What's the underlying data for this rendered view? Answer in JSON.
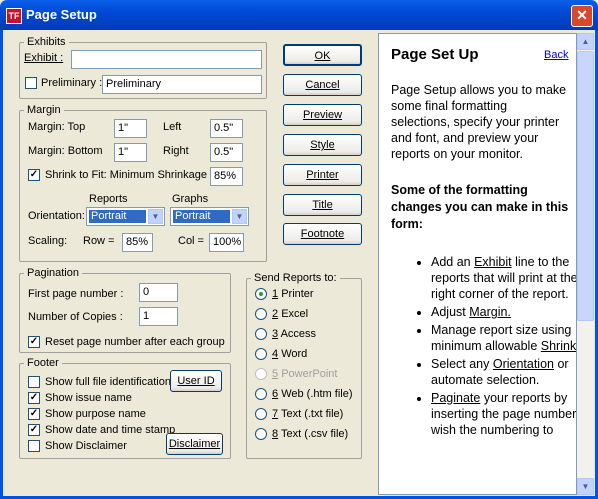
{
  "window": {
    "title": "Page Setup",
    "close": "✕",
    "icon_text": "TF"
  },
  "exhibits": {
    "legend": "Exhibits",
    "exhibit_label": "Exhibit :",
    "exhibit_value": "",
    "preliminary_label": "Preliminary :",
    "preliminary_checked": false,
    "preliminary_value": "Preliminary"
  },
  "margin": {
    "legend": "Margin",
    "top_label": "Margin:  Top",
    "top_value": "1\"",
    "left_label": "Left",
    "left_value": "0.5\"",
    "bottom_label": "Margin:  Bottom",
    "bottom_value": "1\"",
    "right_label": "Right",
    "right_value": "0.5\"",
    "shrink_label": "Shrink to Fit:  Minimum Shrinkage =",
    "shrink_checked": true,
    "shrink_value": "85%",
    "reports_label": "Reports",
    "graphs_label": "Graphs",
    "orientation_label": "Orientation:",
    "reports_orientation": "Portrait",
    "graphs_orientation": "Portrait",
    "scaling_label": "Scaling:",
    "row_label": "Row =",
    "row_value": "85%",
    "col_label": "Col =",
    "col_value": "100%"
  },
  "pagination": {
    "legend": "Pagination",
    "first_page_label": "First page number :",
    "first_page_value": "0",
    "copies_label": "Number of Copies :",
    "copies_value": "1",
    "reset_label": "Reset page number after each group",
    "reset_checked": true
  },
  "send_reports": {
    "legend": "Send Reports to:",
    "options": [
      {
        "num": "1",
        "label": "Printer",
        "selected": true,
        "enabled": true
      },
      {
        "num": "2",
        "label": "Excel",
        "selected": false,
        "enabled": true
      },
      {
        "num": "3",
        "label": "Access",
        "selected": false,
        "enabled": true
      },
      {
        "num": "4",
        "label": "Word",
        "selected": false,
        "enabled": true
      },
      {
        "num": "5",
        "label": "PowerPoint",
        "selected": false,
        "enabled": false
      },
      {
        "num": "6",
        "label": "Web (.htm file)",
        "selected": false,
        "enabled": true
      },
      {
        "num": "7",
        "label": "Text (.txt file)",
        "selected": false,
        "enabled": true
      },
      {
        "num": "8",
        "label": "Text (.csv file)",
        "selected": false,
        "enabled": true
      }
    ]
  },
  "footer": {
    "legend": "Footer",
    "items": [
      {
        "label": "Show full file identification",
        "checked": false
      },
      {
        "label": "Show issue name",
        "checked": true
      },
      {
        "label": "Show purpose name",
        "checked": true
      },
      {
        "label": "Show date and time stamp",
        "checked": true
      },
      {
        "label": "Show Disclaimer",
        "checked": false
      }
    ],
    "user_id_button": "User ID",
    "disclaimer_button": "Disclaimer"
  },
  "buttons": {
    "ok": "OK",
    "cancel": "Cancel",
    "preview": "Preview",
    "style": "Style",
    "printer": "Printer",
    "title": "Title",
    "footnote": "Footnote"
  },
  "help": {
    "title": "Page Set Up",
    "back": "Back",
    "intro": "Page Setup allows you to make some final formatting selections, specify your printer and font, and preview your reports on your monitor.",
    "subheading": "Some of the formatting changes you can make in this form:",
    "bullets": [
      {
        "pre": "Add an ",
        "link": "Exhibit",
        "post": " line to the reports that will print at the top right corner of the report."
      },
      {
        "pre": "Adjust ",
        "link": "Margin.",
        "post": ""
      },
      {
        "pre": "Manage report size using minimum allowable ",
        "link": "Shrinkage",
        "post": "."
      },
      {
        "pre": "Select any ",
        "link": "Orientation",
        "post": " or automate selection."
      },
      {
        "pre": "",
        "link": "Paginate",
        "post": " your reports by inserting the page number you wish the numbering to"
      }
    ]
  }
}
